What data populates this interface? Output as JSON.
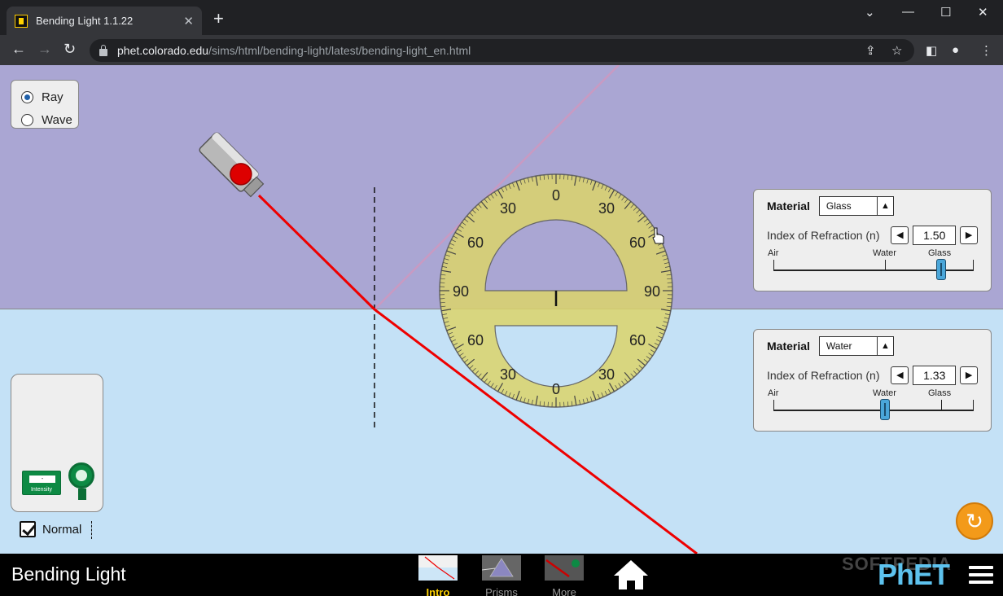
{
  "browser": {
    "tab_title": "Bending Light 1.1.22",
    "url_host": "phet.colorado.edu",
    "url_path": "/sims/html/bending-light/latest/bending-light_en.html"
  },
  "mode": {
    "options": [
      "Ray",
      "Wave"
    ],
    "selected": "Ray"
  },
  "protractor": {
    "top_labels": [
      "0",
      "30",
      "30",
      "60",
      "60",
      "90",
      "90"
    ],
    "bottom_labels": [
      "60",
      "60",
      "30",
      "30",
      "0"
    ]
  },
  "top_material": {
    "label": "Material",
    "selected": "Glass",
    "ior_label": "Index of Refraction (n)",
    "ior_value": "1.50",
    "ior_numeric": 1.5,
    "slider_labels": [
      "Air",
      "Water",
      "Glass"
    ]
  },
  "bottom_material": {
    "label": "Material",
    "selected": "Water",
    "ior_label": "Index of Refraction (n)",
    "ior_value": "1.33",
    "ior_numeric": 1.33,
    "slider_labels": [
      "Air",
      "Water",
      "Glass"
    ]
  },
  "toolbox": {
    "meter_label": "Intensity",
    "meter_screen": "-"
  },
  "normal": {
    "label": "Normal",
    "checked": true
  },
  "navbar": {
    "sim_title": "Bending Light",
    "screens": [
      "Intro",
      "Prisms",
      "More Tools"
    ],
    "active_screen": "Intro",
    "logo": "PhET",
    "watermark": "SOFTPEDIA"
  },
  "colors": {
    "top_medium": "#aaa6d3",
    "bottom_medium": "#c4e1f6",
    "ray": "#ee0000",
    "protractor": "#e6e27a"
  }
}
